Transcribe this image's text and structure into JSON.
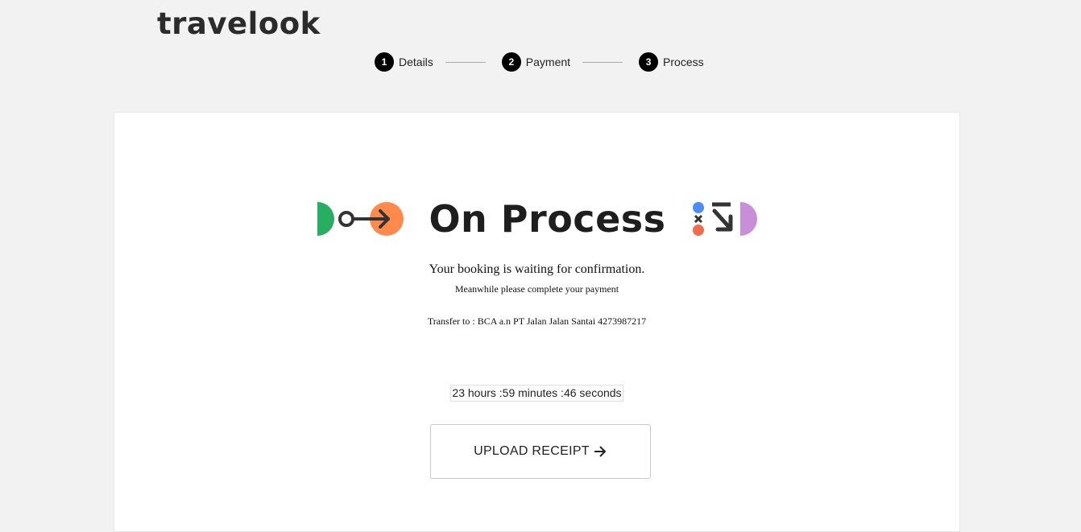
{
  "brand": {
    "logo_text": "travelook"
  },
  "stepper": {
    "steps": [
      {
        "number": "1",
        "label": "Details"
      },
      {
        "number": "2",
        "label": "Payment"
      },
      {
        "number": "3",
        "label": "Process"
      }
    ]
  },
  "status": {
    "title": "On Process",
    "message": "Your booking is waiting for confirmation.",
    "submessage": "Meanwhile please complete your payment",
    "transfer": "Transfer to : BCA a.n PT Jalan Jalan Santai 4273987217"
  },
  "countdown": {
    "text": "23 hours :59 minutes :46 seconds"
  },
  "actions": {
    "upload_label": "UPLOAD RECEIPT"
  },
  "colors": {
    "green": "#27ae60",
    "orange": "#ff8a4c",
    "blue": "#4a8df8",
    "red": "#f26b4e",
    "purple": "#c98ed8",
    "dark": "#333333"
  },
  "icons": {
    "left_decoration": "arrow-flow-icon",
    "right_decoration": "shapes-decoration-icon",
    "upload_arrow": "arrow-right-icon"
  }
}
